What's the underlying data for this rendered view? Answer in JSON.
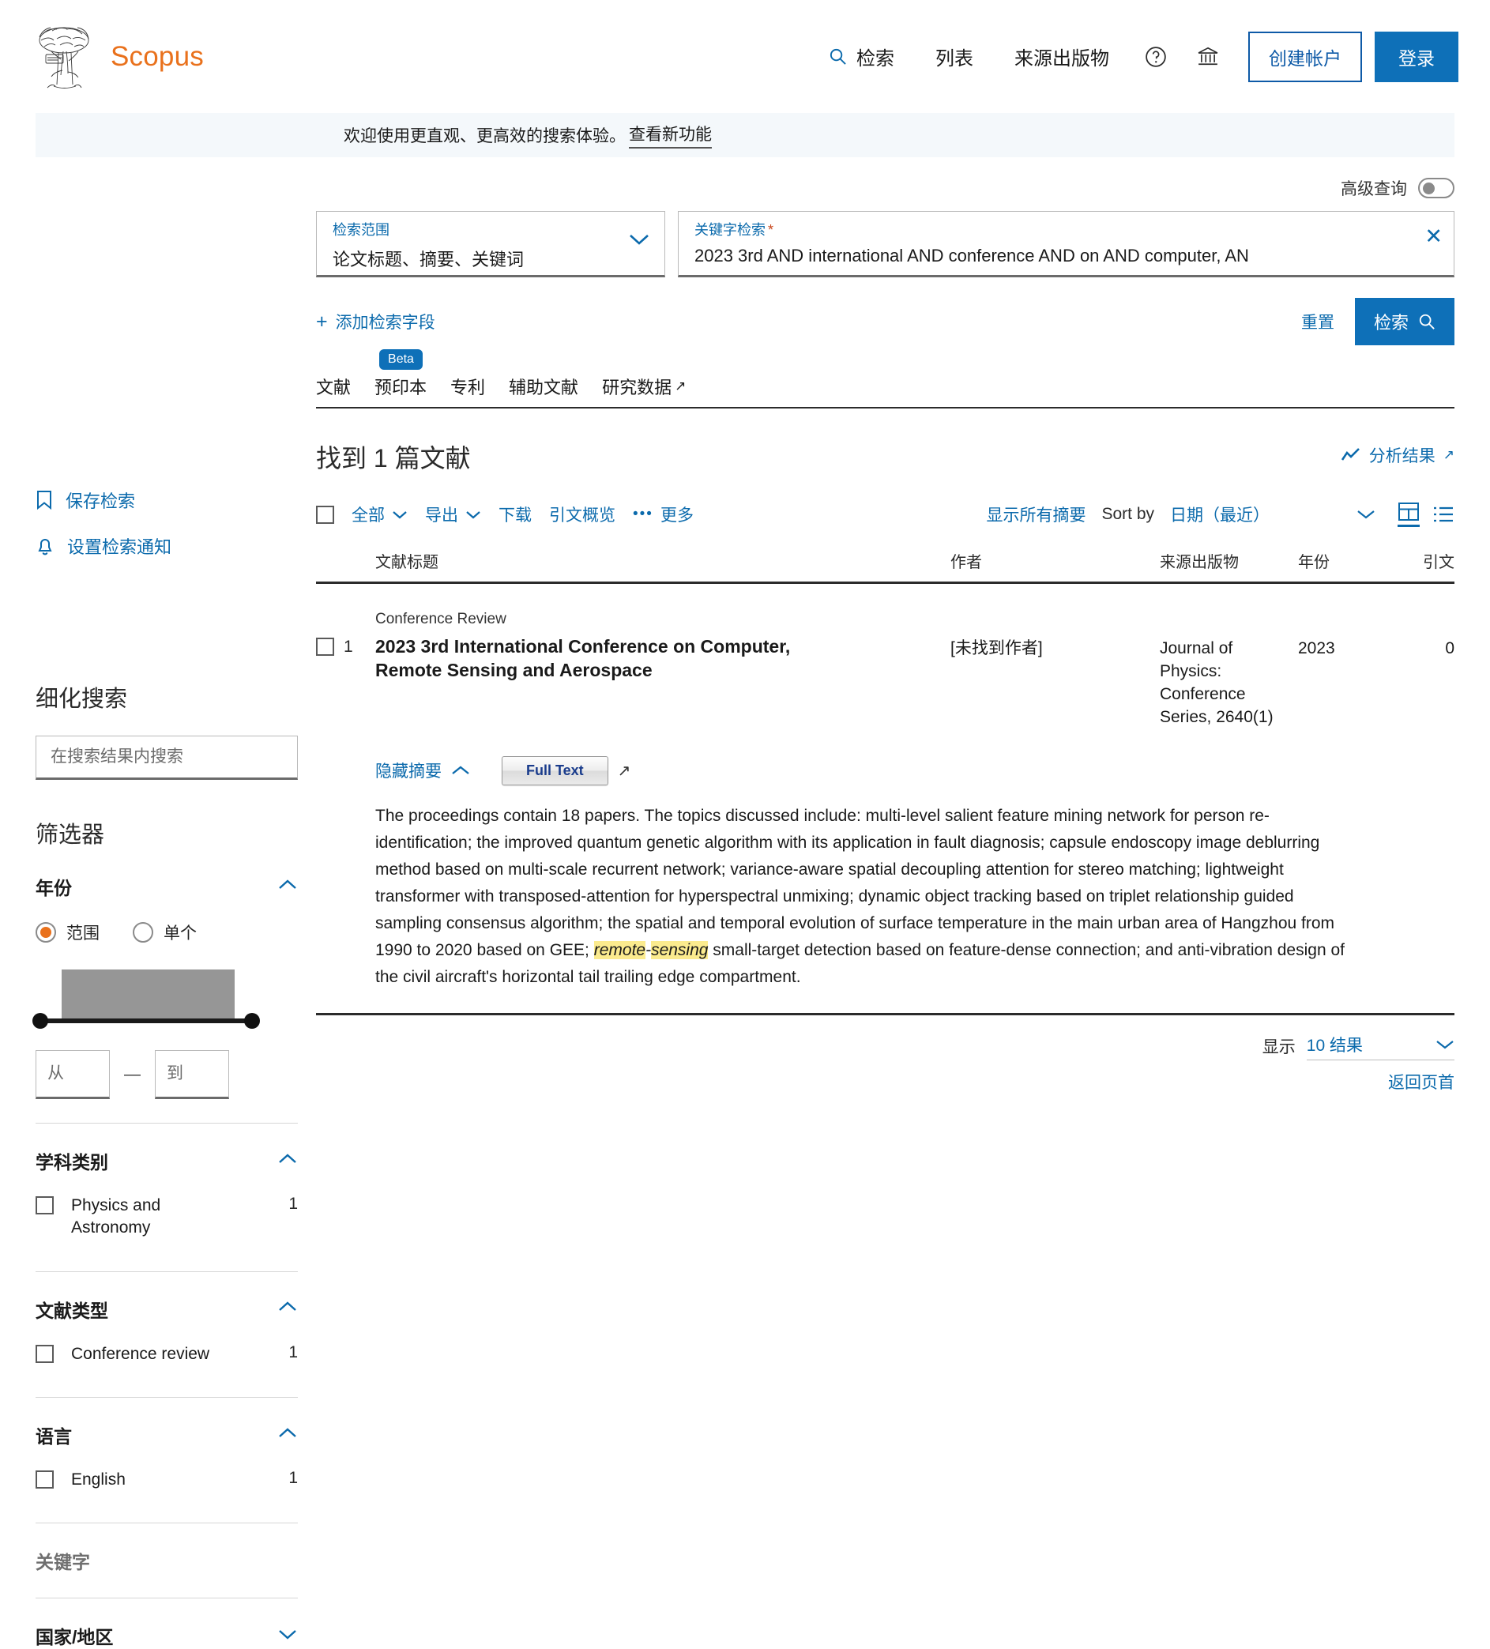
{
  "header": {
    "brand": "Scopus",
    "nav": [
      {
        "label": "检索",
        "icon": "search-icon"
      },
      {
        "label": "列表",
        "icon": null
      },
      {
        "label": "来源出版物",
        "icon": null
      }
    ],
    "help_icon": "help-circle-icon",
    "institution_icon": "institution-icon",
    "create_account": "创建帐户",
    "sign_in": "登录"
  },
  "banner": {
    "text": "欢迎使用更直观、更高效的搜索体验。",
    "link": "查看新功能"
  },
  "sidebar": {
    "save_search": "保存检索",
    "set_alert": "设置检索通知",
    "refine_title": "细化搜索",
    "search_within_placeholder": "在搜索结果内搜索",
    "filters_title": "筛选器",
    "year": {
      "title": "年份",
      "chevron": "up",
      "mode_range": "范围",
      "mode_single": "单个",
      "selected_mode": "范围",
      "from_placeholder": "从",
      "to_placeholder": "到",
      "dash": "—"
    },
    "facets": [
      {
        "title": "学科类别",
        "chevron": "up",
        "muted": false,
        "items": [
          {
            "label": "Physics and Astronomy",
            "count": "1"
          }
        ]
      },
      {
        "title": "文献类型",
        "chevron": "up",
        "muted": false,
        "items": [
          {
            "label": "Conference review",
            "count": "1"
          }
        ]
      },
      {
        "title": "语言",
        "chevron": "up",
        "muted": false,
        "items": [
          {
            "label": "English",
            "count": "1"
          }
        ]
      },
      {
        "title": "关键字",
        "chevron": "none",
        "muted": true,
        "items": []
      },
      {
        "title": "国家/地区",
        "chevron": "down",
        "muted": false,
        "items": []
      }
    ]
  },
  "search": {
    "advanced_label": "高级查询",
    "advanced_on": false,
    "scope_label": "检索范围",
    "scope_value": "论文标题、摘要、关键词",
    "keyword_label": "关键字检索",
    "keyword_required": "*",
    "keyword_value": "2023 3rd AND international AND conference AND on AND computer, AN",
    "add_field": "添加检索字段",
    "reset": "重置",
    "search_button": "检索"
  },
  "tabs": [
    {
      "label": "文献",
      "badge": null,
      "external": false
    },
    {
      "label": "预印本",
      "badge": "Beta",
      "external": false
    },
    {
      "label": "专利",
      "badge": null,
      "external": false
    },
    {
      "label": "辅助文献",
      "badge": null,
      "external": false
    },
    {
      "label": "研究数据",
      "badge": null,
      "external": true
    }
  ],
  "results": {
    "count_text": "找到 1 篇文献",
    "analyze": "分析结果",
    "toolbar": {
      "all": "全部",
      "export": "导出",
      "download": "下载",
      "citation_overview": "引文概览",
      "more": "更多",
      "show_all_abstracts": "显示所有摘要",
      "sort_by_label": "Sort by",
      "sort_value": "日期（最近）"
    },
    "columns": {
      "title": "文献标题",
      "authors": "作者",
      "source": "来源出版物",
      "year": "年份",
      "citations": "引文"
    },
    "rows": [
      {
        "number": "1",
        "doc_type": "Conference Review",
        "title": "2023 3rd International Conference on Computer, Remote Sensing and Aerospace",
        "authors": "[未找到作者]",
        "source": "Journal of Physics: Conference Series, 2640(1)",
        "year": "2023",
        "citations": "0",
        "hide_abstract": "隐藏摘要",
        "full_text_button": "Full Text",
        "abstract_parts": [
          {
            "text": "The proceedings contain 18 papers. The topics discussed include: multi-level salient feature mining network for person re-identification; the improved quantum genetic algorithm with its application in fault diagnosis; capsule endoscopy image deblurring method based on multi-scale recurrent network; variance-aware spatial decoupling attention for stereo matching; lightweight transformer with transposed-attention for hyperspectral unmixing; dynamic object tracking based on triplet relationship guided sampling consensus algorithm; the spatial and temporal evolution of surface temperature in the main urban area of Hangzhou from 1990 to 2020 based on GEE; ",
            "highlight": false
          },
          {
            "text": "remote",
            "highlight": true
          },
          {
            "text": "-",
            "highlight": false,
            "italic": true
          },
          {
            "text": "sensing",
            "highlight": true
          },
          {
            "text": " small-target detection based on feature-dense connection; and anti-vibration design of the civil aircraft's horizontal tail trailing edge compartment.",
            "highlight": false
          }
        ]
      }
    ],
    "footer": {
      "show_label": "显示",
      "show_value": "10 结果",
      "back_to_top": "返回页首"
    }
  },
  "colors": {
    "brand_orange": "#e9711c",
    "link_blue": "#0b6aac",
    "button_blue": "#0e70b8",
    "highlight_yellow": "#fbeb8e",
    "banner_bg": "#f4f8fb"
  }
}
